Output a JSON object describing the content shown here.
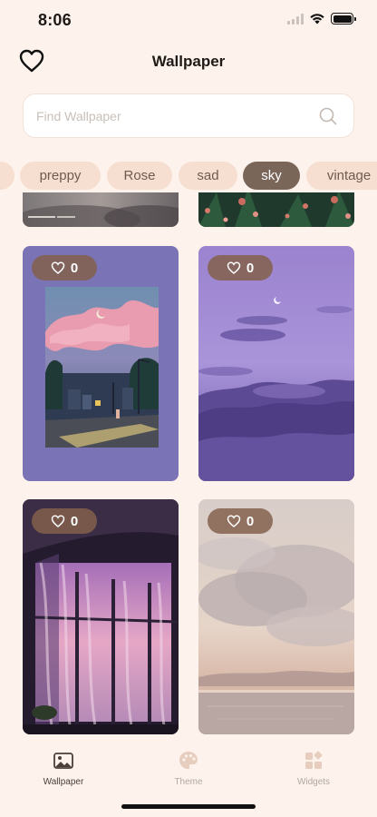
{
  "status_bar": {
    "time": "8:06"
  },
  "header": {
    "title": "Wallpaper"
  },
  "search": {
    "placeholder": "Find Wallpaper"
  },
  "tags": [
    {
      "label": ""
    },
    {
      "label": "preppy"
    },
    {
      "label": "Rose"
    },
    {
      "label": "sad"
    },
    {
      "label": "sky",
      "selected": true
    },
    {
      "label": "vintage"
    }
  ],
  "wallpapers": [
    {
      "likes": "0"
    },
    {
      "likes": "0"
    },
    {
      "likes": "0"
    },
    {
      "likes": "0"
    }
  ],
  "tabbar": {
    "items": [
      {
        "label": "Wallpaper",
        "icon": "image-icon",
        "active": true
      },
      {
        "label": "Theme",
        "icon": "palette-icon"
      },
      {
        "label": "Widgets",
        "icon": "widgets-icon"
      }
    ]
  },
  "colors": {
    "background": "#fdf3ec",
    "tag": "#f6dfd0",
    "tag_active": "#7a6559",
    "like_pill": "#84604c"
  }
}
